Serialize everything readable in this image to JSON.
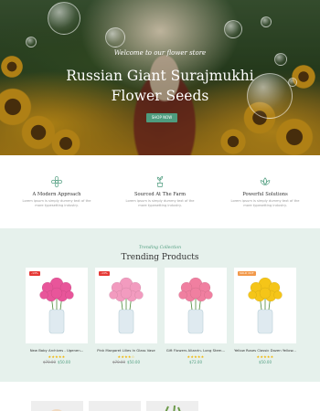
{
  "hero": {
    "subtitle": "Welcome to our flower store",
    "title_line1": "Russian Giant Surajmukhi",
    "title_line2": "Flower Seeds",
    "button": "SHOP NOW"
  },
  "features": [
    {
      "icon": "flower-icon",
      "title": "A Modern Approach",
      "text_line1": "Lorem ipsum is simply dummy text of the",
      "text_line2": "more typesetting industry."
    },
    {
      "icon": "potted-plant-icon",
      "title": "Sourced At The Farm",
      "text_line1": "Lorem ipsum is simply dummy text of the",
      "text_line2": "more typesetting industry."
    },
    {
      "icon": "lotus-icon",
      "title": "Powerful Solutions",
      "text_line1": "Lorem ipsum is simply dummy text of the",
      "text_line2": "more typesetting industry."
    }
  ],
  "trending": {
    "subtitle": "Trending Collection",
    "title": "Trending Products",
    "products": [
      {
        "badge": "-13%",
        "badge_color": "#e53935",
        "name": "New Baby Archives - Ugenen...",
        "stars": "★★★★★",
        "old_price": "$70.00",
        "price": "$50.00",
        "flower_color": "#e8559a"
      },
      {
        "badge": "-13%",
        "badge_color": "#e53935",
        "name": "Pink Margaret Lilies In Glass Vase",
        "stars": "★★★★☆",
        "old_price": "$70.00",
        "price": "$50.00",
        "flower_color": "#f29bbf"
      },
      {
        "badge": "",
        "badge_color": "",
        "name": "Gift Flowers Alizarin- Long Stem...",
        "stars": "★★★★★",
        "old_price": "",
        "price": "$72.00",
        "flower_color": "#f07fa0"
      },
      {
        "badge": "SOLD OUT",
        "badge_color": "#f2994a",
        "name": "Yellow Roses Classic Dozen Yellow...",
        "stars": "★★★★★",
        "old_price": "",
        "price": "$50.00",
        "flower_color": "#f5c518"
      }
    ]
  },
  "colors": {
    "accent": "#4e9c7e",
    "section_bg": "#e6f1ec",
    "star": "#f1b400"
  }
}
